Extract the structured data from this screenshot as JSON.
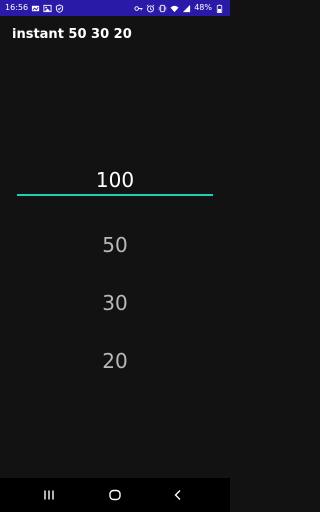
{
  "status_bar": {
    "time": "16:56",
    "battery": "48%",
    "background": "#2a1aa8",
    "icons_left": [
      "gallery-icon",
      "image-icon",
      "shield-icon"
    ],
    "icons_right": [
      "key-icon",
      "alarm-icon",
      "vibrate-icon",
      "wifi-icon",
      "signal-icon",
      "battery-icon"
    ]
  },
  "toolbar": {
    "title": "instant 50 30 20"
  },
  "picker": {
    "selected_value": "100",
    "options": [
      "50",
      "30",
      "20"
    ],
    "accent_color": "#1dcfb3"
  },
  "nav_bar": {
    "buttons": [
      "recents-icon",
      "home-icon",
      "back-icon"
    ]
  }
}
